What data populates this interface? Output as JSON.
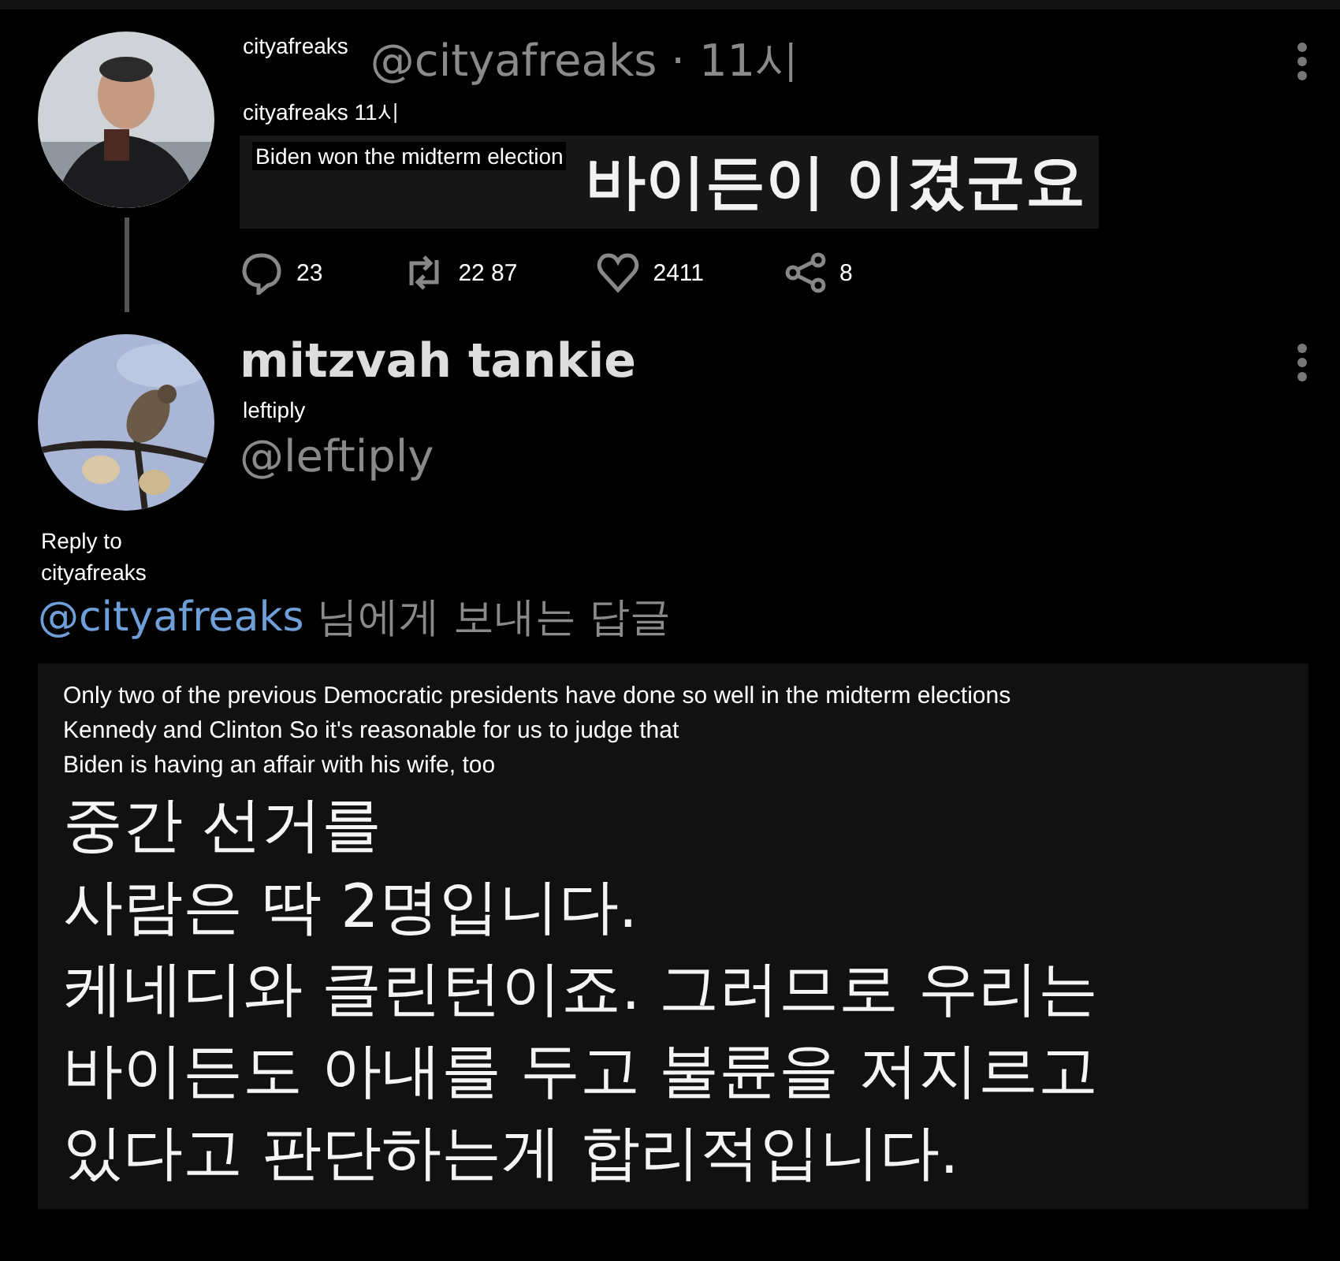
{
  "tweet": {
    "name_label": "cityafreaks",
    "handle_time": "@cityafreaks · 11시",
    "meta_label": "cityafreaks 11시",
    "text_label": "Biden won the midterm election",
    "text": "바이든이 이겼군요",
    "actions": [
      {
        "kind": "reply",
        "count": "23"
      },
      {
        "kind": "retweet",
        "count": "22 87"
      },
      {
        "kind": "like",
        "count": "2411"
      },
      {
        "kind": "share",
        "count": "8"
      }
    ]
  },
  "reply": {
    "name": "mitzvah tankie",
    "handle_label": "leftiply",
    "handle": "@leftiply",
    "reply_label": "Reply to",
    "reply_label_user": "cityafreaks",
    "reply_to": "@cityafreaks",
    "reply_suffix": "님에게 보내는 답글",
    "translation_lines": [
      "Only two of the previous Democratic presidents have done so well in the midterm elections",
      "Kennedy and Clinton So it's reasonable for us to judge that",
      "Biden is having an affair with his wife, too"
    ],
    "body_lines": [
      "중간 선거를",
      "사람은 딱 2명입니다.",
      "케네디와 클린턴이죠. 그러므로 우리는",
      "바이든도 아내를 두고 불륜을 저지르고",
      "있다고 판단하는게 합리적입니다."
    ]
  }
}
